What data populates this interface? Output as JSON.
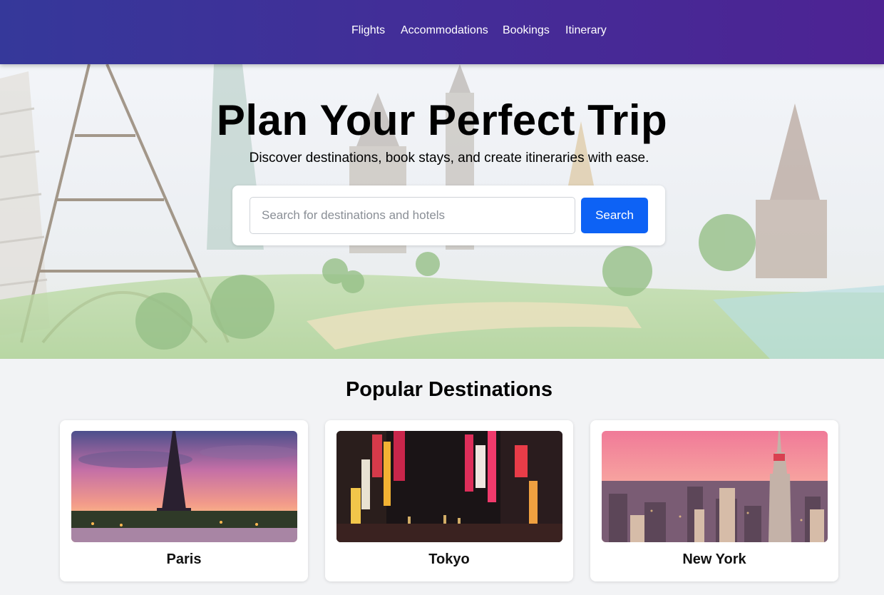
{
  "nav": {
    "items": [
      {
        "label": "Flights"
      },
      {
        "label": "Accommodations"
      },
      {
        "label": "Bookings"
      },
      {
        "label": "Itinerary"
      }
    ]
  },
  "hero": {
    "title": "Plan Your Perfect Trip",
    "subtitle": "Discover destinations, book stays, and create itineraries with ease.",
    "search": {
      "placeholder": "Search for destinations and hotels",
      "value": "",
      "button_label": "Search"
    }
  },
  "destinations": {
    "title": "Popular Destinations",
    "items": [
      {
        "name": "Paris"
      },
      {
        "name": "Tokyo"
      },
      {
        "name": "New York"
      }
    ]
  },
  "colors": {
    "nav_gradient_start": "#35389a",
    "nav_gradient_end": "#4d2393",
    "primary_button": "#0d62f5",
    "page_background": "#f2f3f5"
  }
}
